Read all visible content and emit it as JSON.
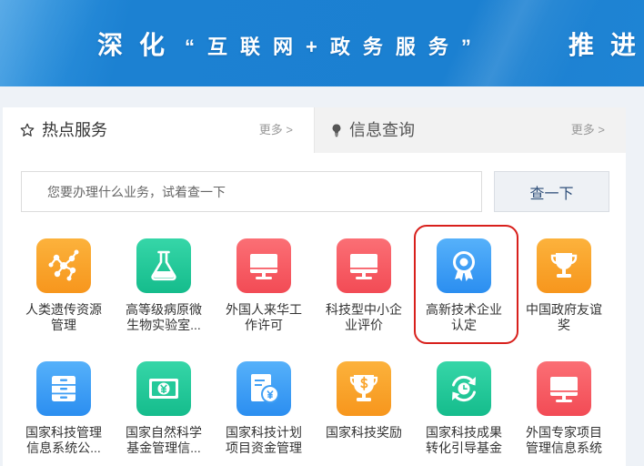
{
  "banner": {
    "title_lead": "深化",
    "title_quote": "“互联网+政务服务”",
    "title_tail": "推进"
  },
  "tabs": [
    {
      "label": "热点服务",
      "more": "更多 >",
      "icon": "star-icon",
      "active": true
    },
    {
      "label": "信息查询",
      "more": "更多 >",
      "icon": "lightbulb-icon",
      "active": false
    }
  ],
  "search": {
    "placeholder": "您要办理什么业务，试着查一下",
    "value": "",
    "button": "查一下"
  },
  "services": [
    {
      "label": "人类遗传资源管理",
      "icon": "molecule-icon",
      "color": "orange",
      "highlighted": false
    },
    {
      "label": "高等级病原微生物实验室...",
      "icon": "flask-icon",
      "color": "teal",
      "highlighted": false
    },
    {
      "label": "外国人来华工作许可",
      "icon": "monitor-icon",
      "color": "red",
      "highlighted": false
    },
    {
      "label": "科技型中小企业评价",
      "icon": "monitor-icon",
      "color": "red",
      "highlighted": false
    },
    {
      "label": "高新技术企业认定",
      "icon": "award-badge-icon",
      "color": "blue",
      "highlighted": true
    },
    {
      "label": "中国政府友谊奖",
      "icon": "trophy-icon",
      "color": "orange",
      "highlighted": false
    },
    {
      "label": "国家科技管理信息系统公...",
      "icon": "cabinet-icon",
      "color": "blue",
      "highlighted": false
    },
    {
      "label": "国家自然科学基金管理信...",
      "icon": "banknote-yen-icon",
      "color": "teal",
      "highlighted": false
    },
    {
      "label": "国家科技计划项目资金管理",
      "icon": "document-yen-icon",
      "color": "blue",
      "highlighted": false
    },
    {
      "label": "国家科技奖励",
      "icon": "trophy-dollar-icon",
      "color": "orange",
      "highlighted": false
    },
    {
      "label": "国家科技成果转化引导基金",
      "icon": "refresh-clock-icon",
      "color": "teal",
      "highlighted": false
    },
    {
      "label": "外国专家项目管理信息系统",
      "icon": "monitor-icon",
      "color": "red",
      "highlighted": false
    }
  ],
  "palette": {
    "orange": [
      "#fcb23c",
      "#f9a42c",
      "#f7961d"
    ],
    "teal": [
      "#36d6a8",
      "#25c99a",
      "#15bc8c"
    ],
    "red": [
      "#fb6f75",
      "#f75d65",
      "#f24b55"
    ],
    "blue": [
      "#56b1fa",
      "#409ff5",
      "#2b8ef0"
    ]
  },
  "highlight_color": "#d8201c"
}
